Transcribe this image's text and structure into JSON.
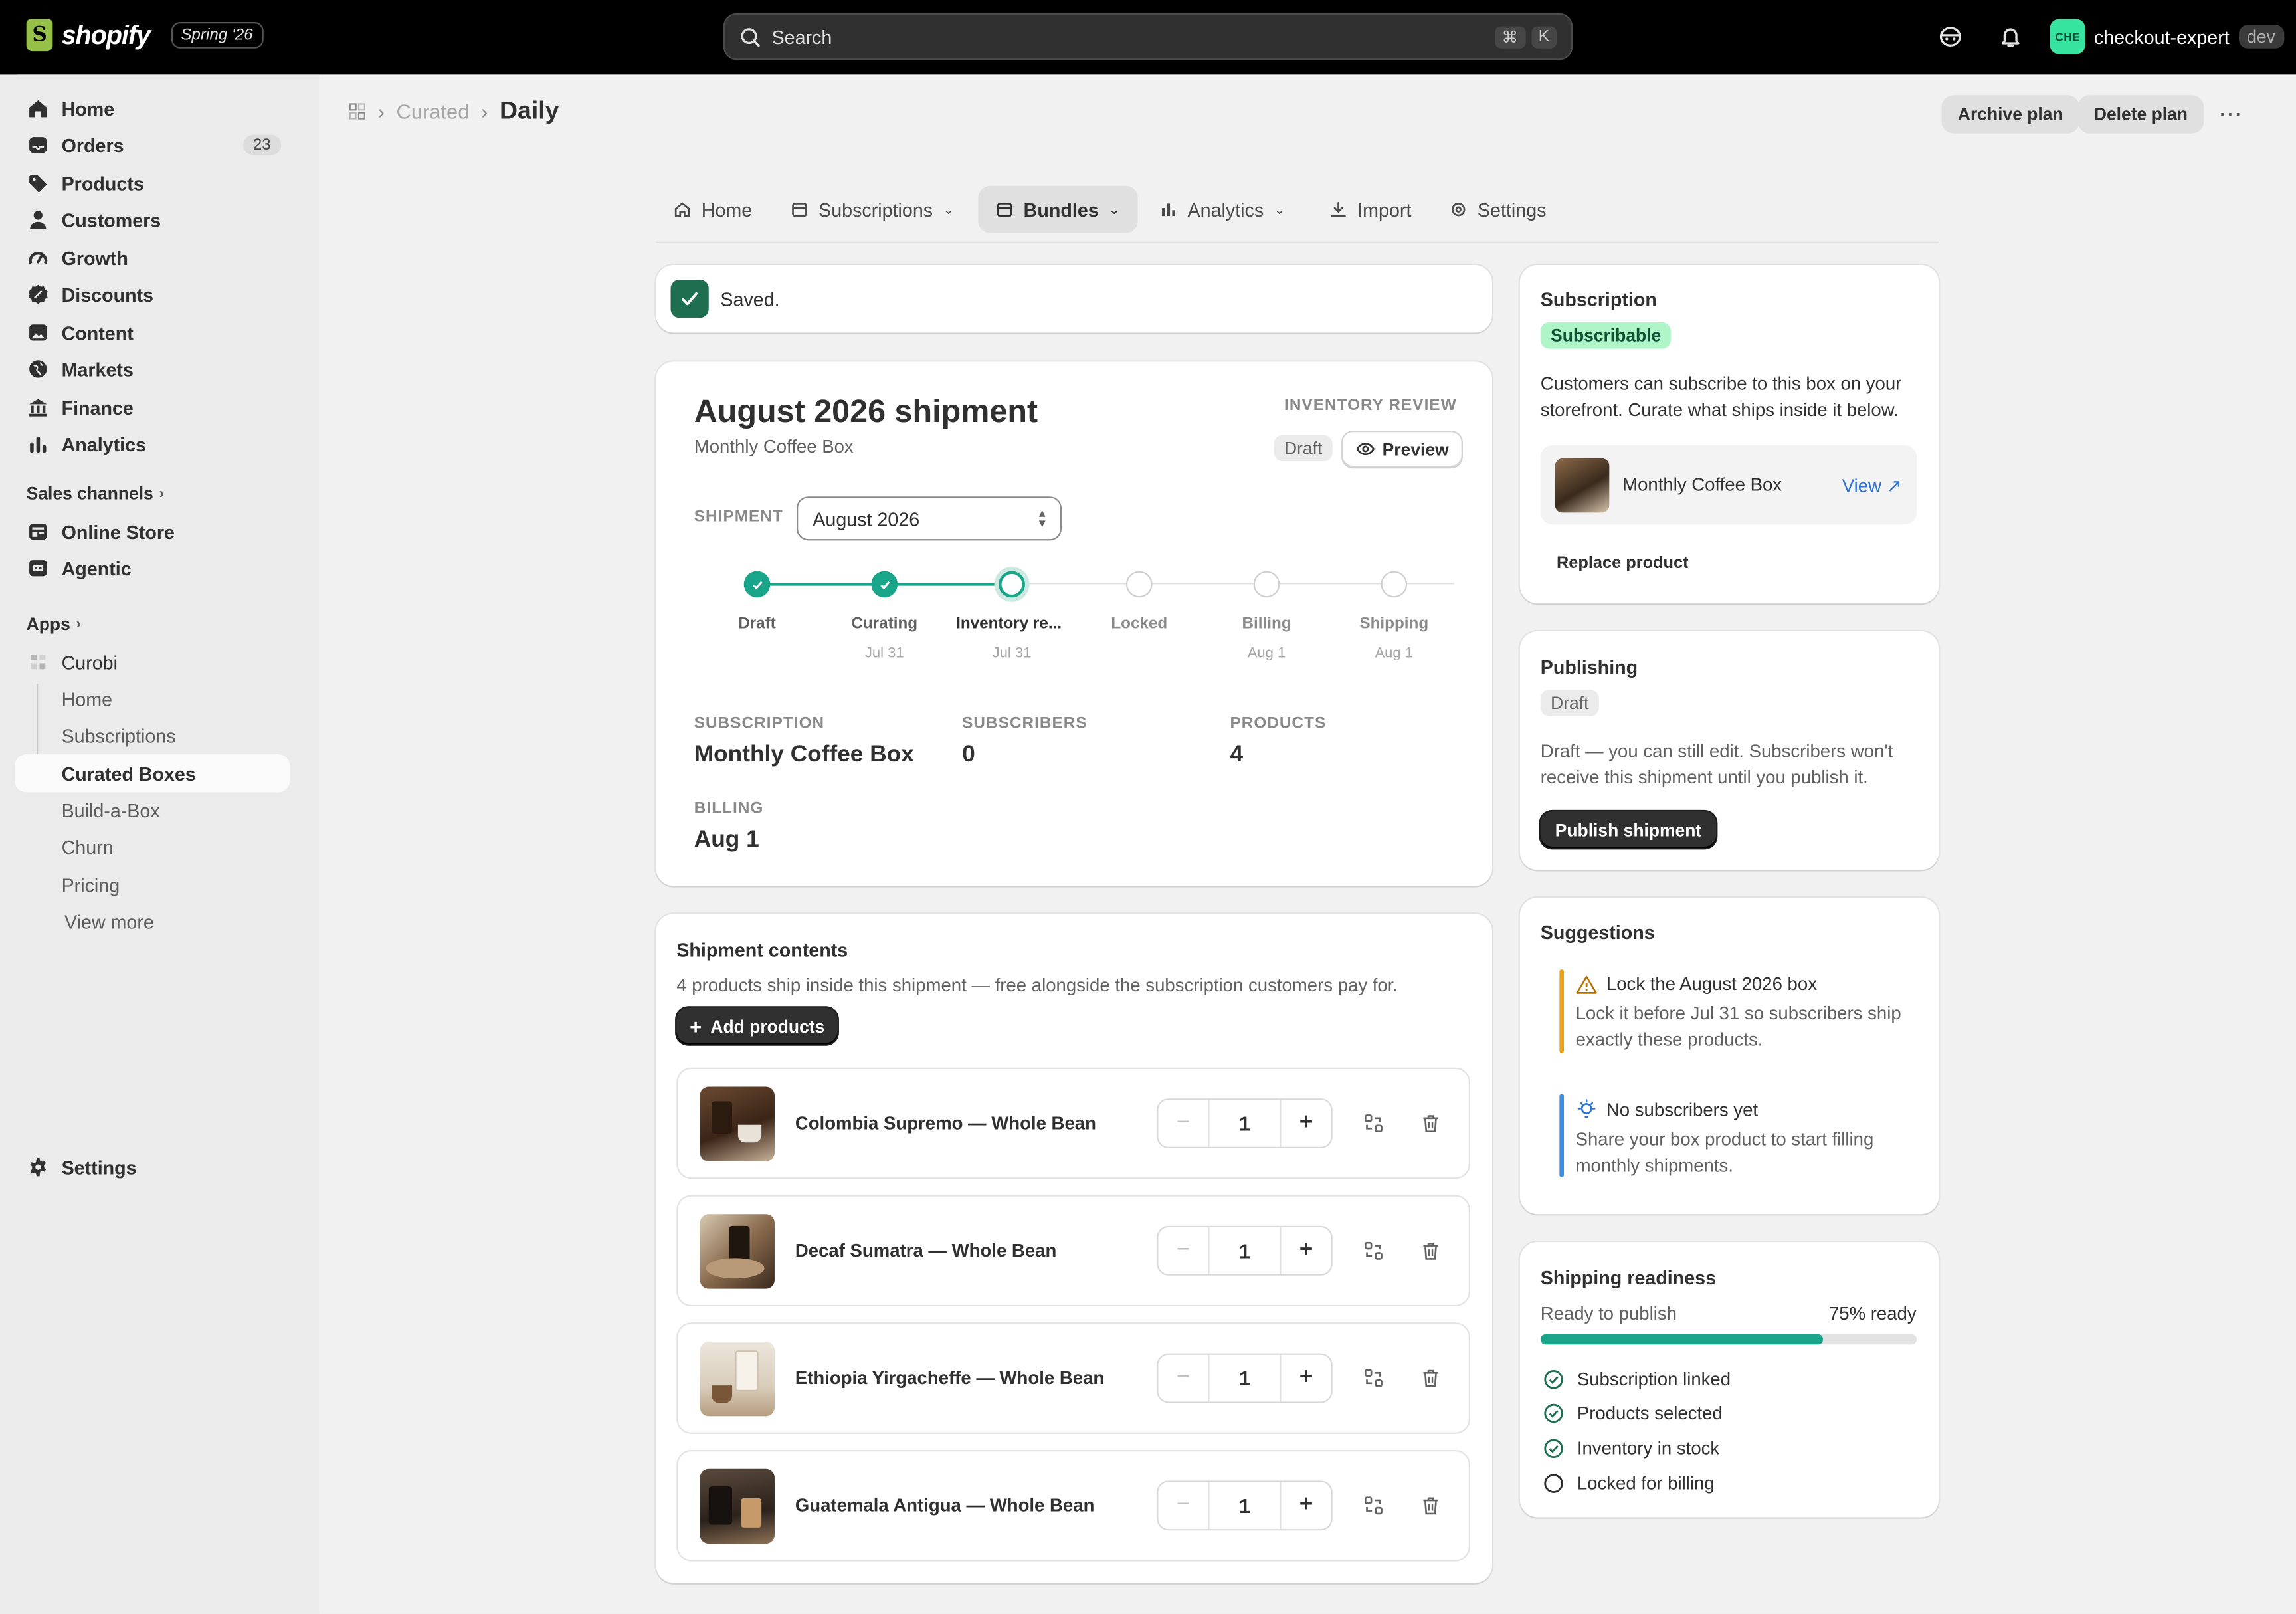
{
  "topbar": {
    "logo_text": "shopify",
    "edition": "Spring '26",
    "search_placeholder": "Search",
    "kbd_cmd": "⌘",
    "kbd_k": "K",
    "account_initials": "CHE",
    "account_name": "checkout-expert",
    "account_env": "dev"
  },
  "sidebar": {
    "items": [
      {
        "label": "Home"
      },
      {
        "label": "Orders",
        "badge": "23"
      },
      {
        "label": "Products"
      },
      {
        "label": "Customers"
      },
      {
        "label": "Growth"
      },
      {
        "label": "Discounts"
      },
      {
        "label": "Content"
      },
      {
        "label": "Markets"
      },
      {
        "label": "Finance"
      },
      {
        "label": "Analytics"
      }
    ],
    "sales_channels_label": "Sales channels",
    "channels": [
      {
        "label": "Online Store"
      },
      {
        "label": "Agentic"
      }
    ],
    "apps_label": "Apps",
    "app_name": "Curobi",
    "app_items": [
      {
        "label": "Home"
      },
      {
        "label": "Subscriptions"
      },
      {
        "label": "Curated Boxes"
      },
      {
        "label": "Build-a-Box"
      },
      {
        "label": "Churn"
      },
      {
        "label": "Pricing"
      }
    ],
    "view_more": "View more",
    "settings": "Settings"
  },
  "header": {
    "crumb_parent": "Curated",
    "crumb_current": "Daily",
    "archive_label": "Archive plan",
    "delete_label": "Delete plan",
    "more": "⋯"
  },
  "tabs": [
    {
      "label": "Home"
    },
    {
      "label": "Subscriptions"
    },
    {
      "label": "Bundles"
    },
    {
      "label": "Analytics"
    },
    {
      "label": "Import"
    },
    {
      "label": "Settings"
    }
  ],
  "toast": {
    "text": "Saved."
  },
  "shipment": {
    "title": "August 2026 shipment",
    "subtitle": "Monthly Coffee Box",
    "status_caption": "INVENTORY REVIEW",
    "draft_label": "Draft",
    "preview_label": "Preview",
    "shipment_label": "SHIPMENT",
    "shipment_value": "August 2026",
    "steps": [
      {
        "label": "Draft",
        "date": ""
      },
      {
        "label": "Curating",
        "date": "Jul 31"
      },
      {
        "label": "Inventory re...",
        "date": "Jul 31"
      },
      {
        "label": "Locked",
        "date": ""
      },
      {
        "label": "Billing",
        "date": "Aug 1"
      },
      {
        "label": "Shipping",
        "date": "Aug 1"
      }
    ],
    "stats": {
      "subscription_cap": "SUBSCRIPTION",
      "subscription_val": "Monthly Coffee Box",
      "subscribers_cap": "SUBSCRIBERS",
      "subscribers_val": "0",
      "products_cap": "PRODUCTS",
      "products_val": "4",
      "billing_cap": "BILLING",
      "billing_val": "Aug 1"
    }
  },
  "contents": {
    "title": "Shipment contents",
    "desc": "4 products ship inside this shipment — free alongside the subscription customers pay for.",
    "add_label": "Add products",
    "products": [
      {
        "name": "Colombia Supremo — Whole Bean",
        "qty": "1"
      },
      {
        "name": "Decaf Sumatra — Whole Bean",
        "qty": "1"
      },
      {
        "name": "Ethiopia Yirgacheffe — Whole Bean",
        "qty": "1"
      },
      {
        "name": "Guatemala Antigua — Whole Bean",
        "qty": "1"
      }
    ]
  },
  "subscription_card": {
    "title": "Subscription",
    "badge": "Subscribable",
    "text": "Customers can subscribe to this box on your storefront. Curate what ships inside it below.",
    "product_name": "Monthly Coffee Box",
    "view_label": "View ↗",
    "replace_label": "Replace product"
  },
  "publishing_card": {
    "title": "Publishing",
    "badge": "Draft",
    "text": "Draft — you can still edit. Subscribers won't receive this shipment until you publish it.",
    "publish_label": "Publish shipment"
  },
  "suggestions": {
    "title": "Suggestions",
    "items": [
      {
        "title": "Lock the August 2026 box",
        "text": "Lock it before Jul 31 so subscribers ship exactly these products.",
        "color": "#e8a317"
      },
      {
        "title": "No subscribers yet",
        "text": "Share your box product to start filling monthly shipments.",
        "color": "#3d8de0"
      }
    ]
  },
  "readiness": {
    "title": "Shipping readiness",
    "label": "Ready to publish",
    "percent_label": "75% ready",
    "percent": 75,
    "checks": [
      {
        "label": "Subscription linked",
        "done": true
      },
      {
        "label": "Products selected",
        "done": true
      },
      {
        "label": "Inventory in stock",
        "done": true
      },
      {
        "label": "Locked for billing",
        "done": false
      }
    ]
  },
  "colors": {
    "accent_teal": "#19a58a",
    "saved_green": "#1f6e50",
    "subscribable_bg": "#aff5c8"
  }
}
